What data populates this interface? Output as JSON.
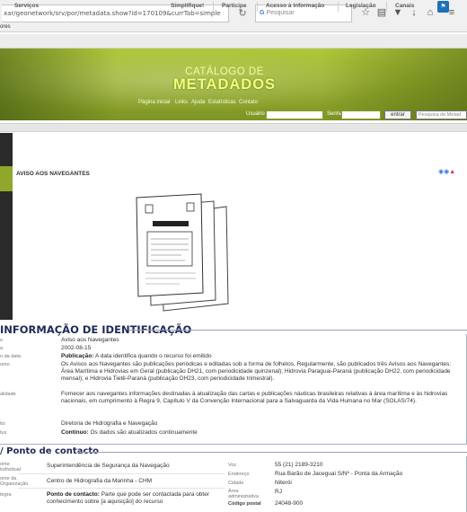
{
  "browser": {
    "url": "xar/geonetwork/srv/por/metadata.show?id=170109&currTab=simple",
    "reload_icon": "reload-icon",
    "search_placeholder": "Pesquisar",
    "bookmarks_label": "ores"
  },
  "gov_bar": {
    "items": [
      "Serviços",
      "Simplifique!",
      "Participe",
      "Acesso à informação",
      "Legislação",
      "Canais"
    ]
  },
  "banner": {
    "line1": "CATÁLOGO DE",
    "line2": "METADADOS",
    "nav": [
      "Página inicial",
      "Links",
      "Ajuda",
      "Estatísticas",
      "Contato"
    ],
    "user_label": "Usuário",
    "password_label": "Senha",
    "login_button": "entrar",
    "search_placeholder": "Pesquisa de Metad"
  },
  "record": {
    "title": "AVISO AOS NAVEGANTES"
  },
  "identification": {
    "heading": "INFORMAÇÃO DE IDENTIFICAÇÃO",
    "rows": [
      {
        "label": "o",
        "value": "Aviso aos Navegantes"
      },
      {
        "label": "a",
        "value": "2002-08-15"
      },
      {
        "label": "o da data",
        "value_bold": "Publicação:",
        "value": "A data identifica quando o recurso foi emitido"
      },
      {
        "label": "umo",
        "value": "Os Avisos aos Navegantes são publicações periódicas e editadas sob a forma de folhetos. Regularmente, são publicados três Avisos aos Navegantes: Área Marítima e Hidrovias em Geral (publicação DH21, com periodicidade quinzenal); Hidrovia Paraguai-Paraná (publicação DH22, com periodicidade mensal); e Hidrovia Tietê-Paraná (publicação DH23, com periodicidade trimestral)."
      },
      {
        "label": "alidade",
        "value": "Fornecer aos navegantes informações destinadas à atualização das cartas e publicações náuticas brasileiras relativas à área marítima e às hidrovias nacionais, em cumprimento à Regra 9, Capítulo V da Convenção Internacional para a Salvaguarda da Vida Humana no Mar (SOLAS/74)."
      },
      {
        "label": "ito",
        "value": "Diretoria de Hidrografia e Navegação"
      },
      {
        "label": "tus",
        "value_bold": "Contínuo:",
        "value": "Os dados são atualizados continuamente"
      }
    ]
  },
  "contact": {
    "heading": "/ Ponto de contacto",
    "left_rows": [
      {
        "label": "ome individual",
        "value": "Superintendência de Segurança da Navegação"
      },
      {
        "label": "ome da Organização",
        "value": "Centro de Hidrografia da Marinha - CHM"
      },
      {
        "label": "tegra",
        "value_bold": "Ponto de contacto:",
        "value": "Parte que pode ser contactada para obter conhecimento sobre [a aquisição] do recurso"
      }
    ],
    "right_rows": [
      {
        "label": "Voz",
        "value": "55 (21) 2189-3210"
      },
      {
        "label": "Endereço",
        "value": "Rua Barão de Jaceguai S/Nº - Ponta da Armação"
      },
      {
        "label": "Cidade",
        "value": "Niterói"
      },
      {
        "label": "Área administrativa",
        "value": "RJ"
      },
      {
        "label": "Código postal",
        "value": "24048-900"
      }
    ]
  }
}
